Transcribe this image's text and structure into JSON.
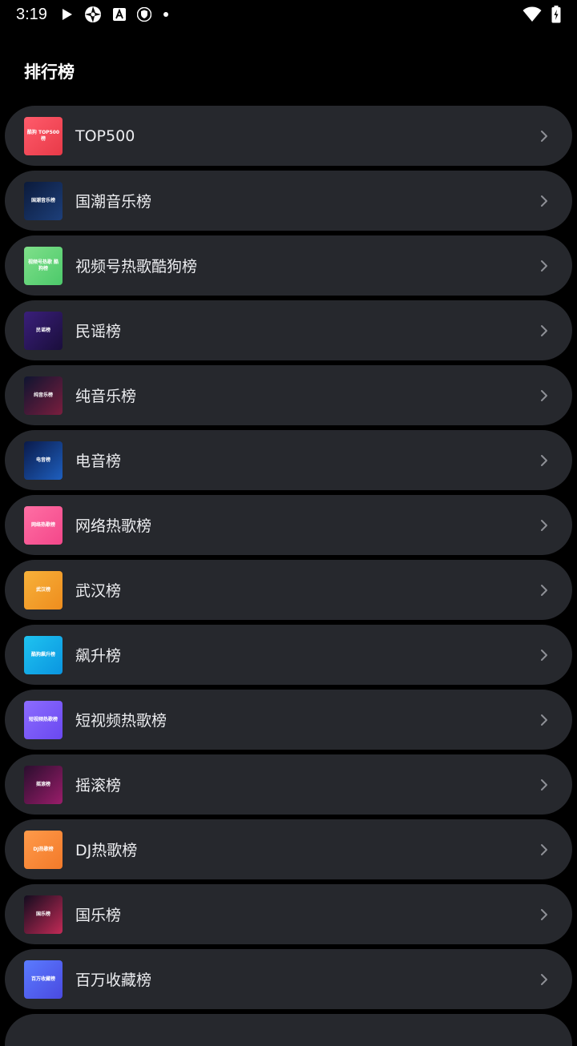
{
  "status": {
    "time": "3:19",
    "icons_left": [
      "play-icon",
      "aperture-icon",
      "app-a-icon",
      "shield-icon",
      "dot-icon"
    ],
    "icons_right": [
      "wifi-icon",
      "battery-icon"
    ]
  },
  "page": {
    "title": "排行榜"
  },
  "rankings": [
    {
      "label": "TOP500",
      "thumb_text": "酷狗 TOP500榜",
      "colors": [
        "#ff5b6b",
        "#e83a48"
      ]
    },
    {
      "label": "国潮音乐榜",
      "thumb_text": "国潮音乐榜",
      "colors": [
        "#0b1a3a",
        "#1d3f7a"
      ]
    },
    {
      "label": "视频号热歌酷狗榜",
      "thumb_text": "视频号热歌 酷狗榜",
      "colors": [
        "#7fe08a",
        "#4cc96a"
      ]
    },
    {
      "label": "民谣榜",
      "thumb_text": "民谣榜",
      "colors": [
        "#3a1f7a",
        "#1a0e3c"
      ]
    },
    {
      "label": "纯音乐榜",
      "thumb_text": "纯音乐榜",
      "colors": [
        "#0e1430",
        "#7a1e3e"
      ]
    },
    {
      "label": "电音榜",
      "thumb_text": "电音榜",
      "colors": [
        "#0a1a4a",
        "#1e5fbf"
      ]
    },
    {
      "label": "网络热歌榜",
      "thumb_text": "网络热歌榜",
      "colors": [
        "#ff6fa4",
        "#f3478a"
      ]
    },
    {
      "label": "武汉榜",
      "thumb_text": "武汉榜",
      "colors": [
        "#f7b13a",
        "#ee8d1e"
      ]
    },
    {
      "label": "飙升榜",
      "thumb_text": "酷狗飙升榜",
      "colors": [
        "#1fc3f0",
        "#0a95e0"
      ]
    },
    {
      "label": "短视频热歌榜",
      "thumb_text": "短视频热歌榜",
      "colors": [
        "#8c6cff",
        "#6a48f0"
      ]
    },
    {
      "label": "摇滚榜",
      "thumb_text": "摇滚榜",
      "colors": [
        "#2a0e2e",
        "#9a1d6a"
      ]
    },
    {
      "label": "DJ热歌榜",
      "thumb_text": "DJ热歌榜",
      "colors": [
        "#ff9a4a",
        "#f27a2a"
      ]
    },
    {
      "label": "国乐榜",
      "thumb_text": "国乐榜",
      "colors": [
        "#120c1e",
        "#c22a56"
      ]
    },
    {
      "label": "百万收藏榜",
      "thumb_text": "百万收藏榜",
      "colors": [
        "#5a7bff",
        "#4a4ae0"
      ]
    }
  ],
  "theme": {
    "background": "#000000",
    "card": "#26282d",
    "text": "#ecedf0",
    "chevron": "#8e9096"
  }
}
